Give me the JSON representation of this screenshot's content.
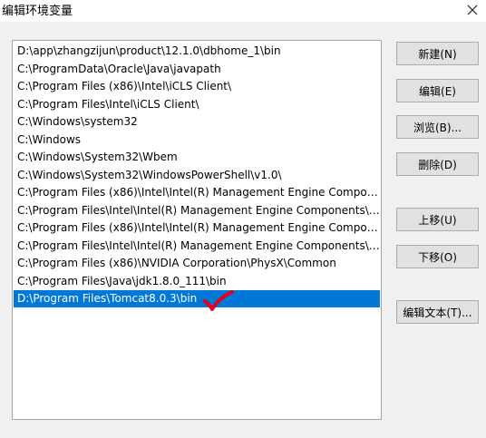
{
  "dialog": {
    "title": "编辑环境变量",
    "close_glyph": "✕"
  },
  "path_list": {
    "items": [
      "D:\\app\\zhangzijun\\product\\12.1.0\\dbhome_1\\bin",
      "C:\\ProgramData\\Oracle\\Java\\javapath",
      "C:\\Program Files (x86)\\Intel\\iCLS Client\\",
      "C:\\Program Files\\Intel\\iCLS Client\\",
      "C:\\Windows\\system32",
      "C:\\Windows",
      "C:\\Windows\\System32\\Wbem",
      "C:\\Windows\\System32\\WindowsPowerShell\\v1.0\\",
      "C:\\Program Files (x86)\\Intel\\Intel(R) Management Engine Compon…",
      "C:\\Program Files\\Intel\\Intel(R) Management Engine Components\\…",
      "C:\\Program Files (x86)\\Intel\\Intel(R) Management Engine Compon…",
      "C:\\Program Files\\Intel\\Intel(R) Management Engine Components\\I…",
      "C:\\Program Files (x86)\\NVIDIA Corporation\\PhysX\\Common",
      "C:\\Program Files\\Java\\jdk1.8.0_111\\bin",
      "D:\\Program Files\\Tomcat8.0.3\\bin"
    ],
    "selected_index": 14,
    "selection_color": "#0078d7",
    "annotation_color": "#e3001b"
  },
  "buttons": {
    "new": "新建(N)",
    "edit": "编辑(E)",
    "browse": "浏览(B)...",
    "delete": "删除(D)",
    "move_up": "上移(U)",
    "move_down": "下移(O)",
    "edit_text": "编辑文本(T)..."
  }
}
